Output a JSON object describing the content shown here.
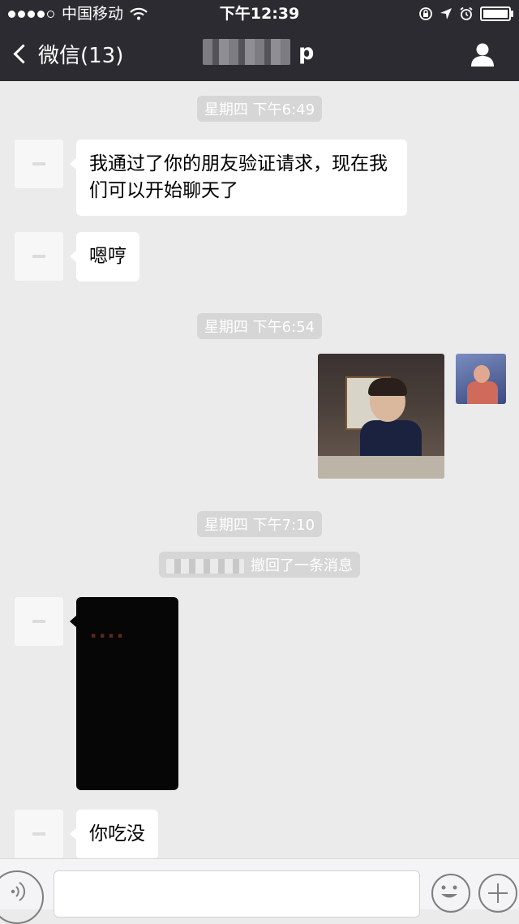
{
  "status_bar": {
    "carrier": "中国移动",
    "time": "下午12:39",
    "signal_dots_filled": 4,
    "signal_dots_total": 5,
    "battery_level": 1.0
  },
  "nav": {
    "back_label": "微信(13)",
    "title_suffix": "p"
  },
  "chat": {
    "timestamps": [
      "星期四 下午6:49",
      "星期四 下午6:54",
      "星期四 下午7:10"
    ],
    "messages": [
      {
        "text": "我通过了你的朋友验证请求，现在我们可以开始聊天了"
      },
      {
        "text": "嗯哼"
      },
      {
        "text": "你吃没"
      }
    ],
    "recall_notice": "撤回了一条消息"
  },
  "input_bar": {
    "icons": [
      "voice-icon",
      "emoji-icon",
      "plus-icon"
    ]
  }
}
